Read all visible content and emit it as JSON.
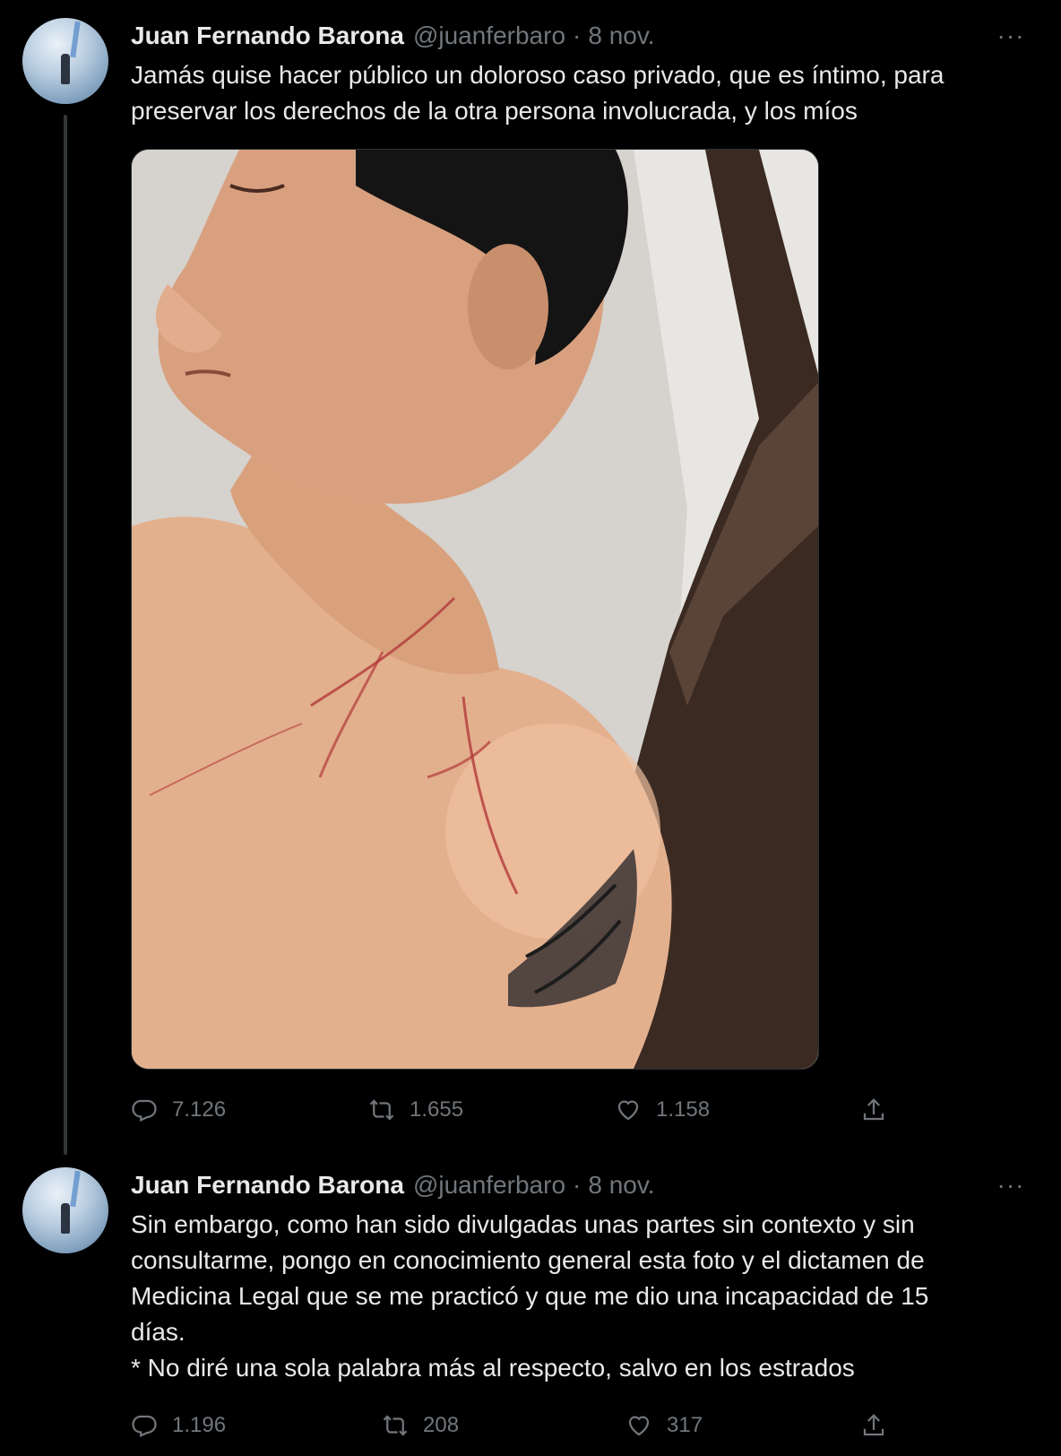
{
  "tweets": [
    {
      "author": {
        "name": "Juan Fernando Barona",
        "handle": "@juanferbaro",
        "separator": "·",
        "date": "8 nov."
      },
      "more_label": "···",
      "text": "Jamás quise hacer público un doloroso caso privado, que es íntimo, para\npreservar los derechos de la otra persona involucrada, y los míos",
      "media": {
        "icon": "photo",
        "alt_subject": "shirtless man with scratch marks on neck and chest"
      },
      "actions": {
        "replies": "7.126",
        "retweets": "1.655",
        "likes": "1.158"
      }
    },
    {
      "author": {
        "name": "Juan Fernando Barona",
        "handle": "@juanferbaro",
        "separator": "·",
        "date": "8 nov."
      },
      "more_label": "···",
      "text": "Sin embargo, como han sido divulgadas unas partes sin contexto y sin\nconsultarme, pongo en conocimiento general esta foto y el dictamen de\nMedicina Legal que se me practicó y que me dio una incapacidad de 15\ndías.\n* No diré una sola palabra más al respecto, salvo en los estrados",
      "actions": {
        "replies": "1.196",
        "retweets": "208",
        "likes": "317"
      }
    }
  ],
  "colors": {
    "background": "#000000",
    "text": "#e7e9ea",
    "secondary": "#71767b",
    "thread_line": "#333639"
  },
  "icons": [
    "reply-icon",
    "retweet-icon",
    "like-icon",
    "share-icon",
    "more-icon"
  ]
}
